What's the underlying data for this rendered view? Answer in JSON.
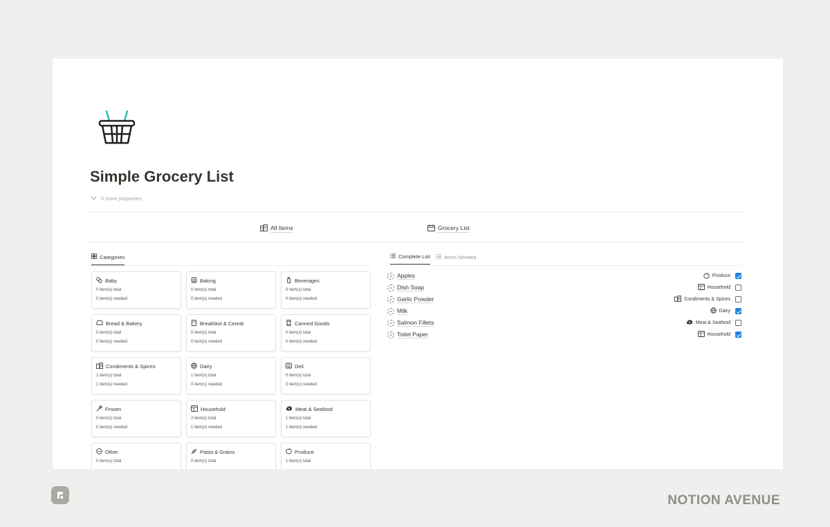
{
  "page": {
    "title": "Simple Grocery List",
    "more_properties": "5 more properties"
  },
  "views": {
    "all_items": {
      "label": "All Items",
      "icon": "buildings-icon"
    },
    "grocery_list": {
      "label": "Grocery List",
      "icon": "calendar-icon"
    }
  },
  "categories_tab": {
    "label": "Categories",
    "icon": "gallery-grid-icon"
  },
  "categories": [
    {
      "name": "Baby",
      "icon": "baby-icon",
      "total": "0 item(s) total",
      "needed": "0 item(s) needed"
    },
    {
      "name": "Baking",
      "icon": "baking-icon",
      "total": "0 item(s) total",
      "needed": "0 item(s) needed"
    },
    {
      "name": "Beverages",
      "icon": "bottle-icon",
      "total": "0 item(s) total",
      "needed": "0 item(s) needed"
    },
    {
      "name": "Bread & Bakery",
      "icon": "bread-icon",
      "total": "0 item(s) total",
      "needed": "0 item(s) needed"
    },
    {
      "name": "Breakfast & Cereal",
      "icon": "cereal-icon",
      "total": "0 item(s) total",
      "needed": "0 item(s) needed"
    },
    {
      "name": "Canned Goods",
      "icon": "can-icon",
      "total": "0 item(s) total",
      "needed": "0 item(s) needed"
    },
    {
      "name": "Condiments & Spices",
      "icon": "buildings-icon",
      "total": "1 item(s) total",
      "needed": "1 item(s) needed"
    },
    {
      "name": "Dairy",
      "icon": "globe-icon",
      "total": "1 item(s) total",
      "needed": "0 item(s) needed"
    },
    {
      "name": "Deli",
      "icon": "deli-icon",
      "total": "0 item(s) total",
      "needed": "0 item(s) needed"
    },
    {
      "name": "Frozen",
      "icon": "frozen-icon",
      "total": "0 item(s) total",
      "needed": "0 item(s) needed"
    },
    {
      "name": "Household",
      "icon": "household-icon",
      "total": "2 item(s) total",
      "needed": "1 item(s) needed"
    },
    {
      "name": "Meat & Seafood",
      "icon": "meat-icon",
      "total": "1 item(s) total",
      "needed": "1 item(s) needed"
    },
    {
      "name": "Other",
      "icon": "other-icon",
      "total": "0 item(s) total",
      "needed": ""
    },
    {
      "name": "Pasta & Grains",
      "icon": "pasta-icon",
      "total": "0 item(s) total",
      "needed": ""
    },
    {
      "name": "Produce",
      "icon": "apple-icon",
      "total": "1 item(s) total",
      "needed": ""
    }
  ],
  "list_tabs": [
    {
      "label": "Complete List",
      "icon": "list-icon",
      "active": true
    },
    {
      "label": "Items Needed",
      "icon": "list-icon",
      "active": false
    }
  ],
  "items": [
    {
      "name": "Apples",
      "category": "Produce",
      "cat_icon": "apple-icon",
      "checked": true
    },
    {
      "name": "Dish Soap",
      "category": "Household",
      "cat_icon": "household-icon",
      "checked": false
    },
    {
      "name": "Garlic Powder",
      "category": "Condiments & Spices",
      "cat_icon": "buildings-icon",
      "checked": false
    },
    {
      "name": "Milk",
      "category": "Dairy",
      "cat_icon": "globe-icon",
      "checked": true
    },
    {
      "name": "Salmon Fillets",
      "category": "Meat & Seafood",
      "cat_icon": "meat-icon",
      "checked": false
    },
    {
      "name": "Toilet Paper",
      "category": "Household",
      "cat_icon": "household-icon",
      "checked": true
    }
  ],
  "brand": {
    "name": "NOTION AVENUE",
    "logo_icon": "notion-avenue-logo-icon"
  },
  "colors": {
    "accent_teal": "#2bbfa8",
    "checkbox_blue": "#2383e2",
    "backdrop": "#efefed"
  }
}
